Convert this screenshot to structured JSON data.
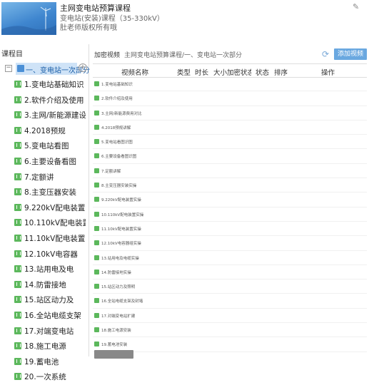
{
  "course": {
    "title": "主网变电站预算课程",
    "subtitle": "变电站(安装)课程（35-330kV）",
    "copyright": "肚老师版权所有哦"
  },
  "sidebar": {
    "title": "课程目",
    "chapter": {
      "toggle": "−",
      "label": "一、变电站一次部分",
      "add": "+"
    },
    "items": [
      {
        "label": "1.变电站基础知识"
      },
      {
        "label": "2.软件介绍及使用"
      },
      {
        "label": "3.主网/新能源建设"
      },
      {
        "label": "4.2018预规"
      },
      {
        "label": "5.变电站看图"
      },
      {
        "label": "6.主要设备看图"
      },
      {
        "label": "7.定额讲"
      },
      {
        "label": "8.主变压器安装"
      },
      {
        "label": "9.220kV配电装置"
      },
      {
        "label": "10.110kV配电装置"
      },
      {
        "label": "11.10kV配电装置"
      },
      {
        "label": "12.10kV电容器"
      },
      {
        "label": "13.站用电及电"
      },
      {
        "label": "14.防雷接地"
      },
      {
        "label": "15.站区动力及"
      },
      {
        "label": "16.全站电缆支架"
      },
      {
        "label": "17.对端变电站"
      },
      {
        "label": "18.施工电源"
      },
      {
        "label": "19.蓄电池"
      },
      {
        "label": "20.一次系统"
      }
    ]
  },
  "main": {
    "breadcrumb_bold": "加密视频",
    "breadcrumb_rest": "主网变电站预算课程/一、变电站一次部分",
    "add_video": "添加视频",
    "columns": [
      "视频名称",
      "类型",
      "时长",
      "大小",
      "加密状态",
      "状态",
      "排序",
      "操作"
    ],
    "videos": [
      {
        "name": "1.变电站基础知识"
      },
      {
        "name": "2.软件介绍及使用"
      },
      {
        "name": "3.主网/新能源费用对比"
      },
      {
        "name": "4.2018预规讲解"
      },
      {
        "name": "5.变电站看图识图"
      },
      {
        "name": "6.主要设备看图识图"
      },
      {
        "name": "7.定额讲解"
      },
      {
        "name": "8.主变压器安装实操"
      },
      {
        "name": "9.220kV配电装置实操"
      },
      {
        "name": "10.110kV配电装置实操"
      },
      {
        "name": "11.10kV配电装置实操"
      },
      {
        "name": "12.10kV电容器组实操"
      },
      {
        "name": "13.站用电及电缆实操"
      },
      {
        "name": "14.防雷接地实操"
      },
      {
        "name": "15.站区动力及照明"
      },
      {
        "name": "16.全站电缆支架及封堵"
      },
      {
        "name": "17.对端变电站扩建"
      },
      {
        "name": "18.施工电源安装"
      },
      {
        "name": "19.蓄电池安装"
      }
    ]
  },
  "colors": {
    "accent": "#6aa8e0",
    "selected_bg": "#cfe3f7",
    "video_icon": "#5cb85c"
  }
}
